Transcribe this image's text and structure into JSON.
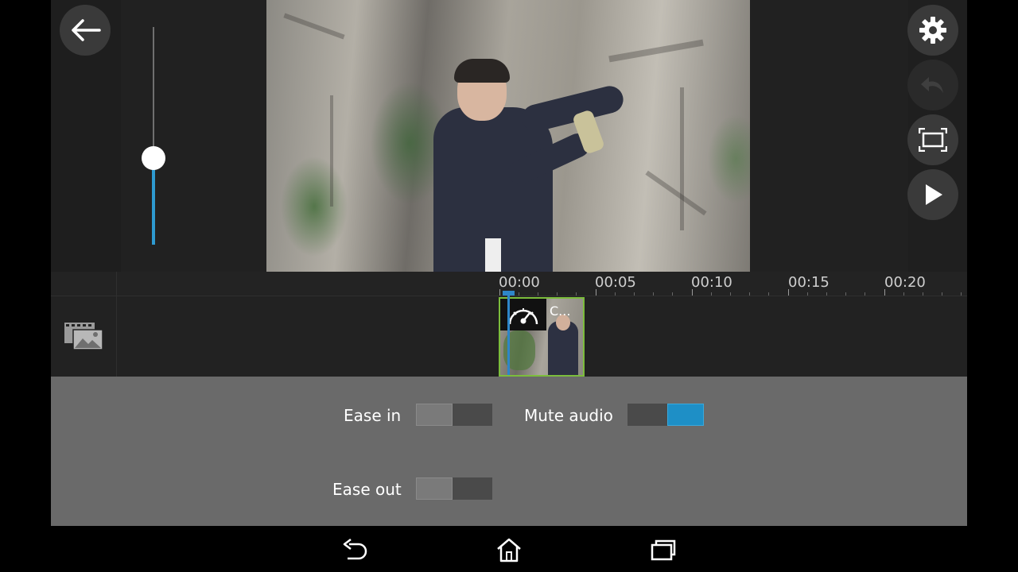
{
  "app": {
    "accent": "#2e9ad0",
    "clip_border": "#7cbd3c",
    "panel_bg": "#6a6a6a"
  },
  "top_left": {
    "back_icon": "arrow-left-icon"
  },
  "volume_slider": {
    "level_percent": 40
  },
  "right_toolbar": {
    "buttons": [
      {
        "icon": "gear-icon",
        "enabled": true
      },
      {
        "icon": "undo-icon",
        "enabled": false
      },
      {
        "icon": "fullscreen-icon",
        "enabled": true
      },
      {
        "icon": "play-icon",
        "enabled": true
      }
    ]
  },
  "timeline": {
    "ticks": [
      "00:00",
      "00:05",
      "00:10",
      "00:15",
      "00:20"
    ],
    "track_icon": "media-library-icon",
    "clip": {
      "label": "C...",
      "badge_icon": "speed-gauge-icon"
    }
  },
  "settings": {
    "ease_in": {
      "label": "Ease in",
      "on": false
    },
    "ease_out": {
      "label": "Ease out",
      "on": false
    },
    "mute_audio": {
      "label": "Mute audio",
      "on": true
    }
  },
  "system_nav": {
    "buttons": [
      "back-icon",
      "home-icon",
      "recents-icon"
    ]
  }
}
